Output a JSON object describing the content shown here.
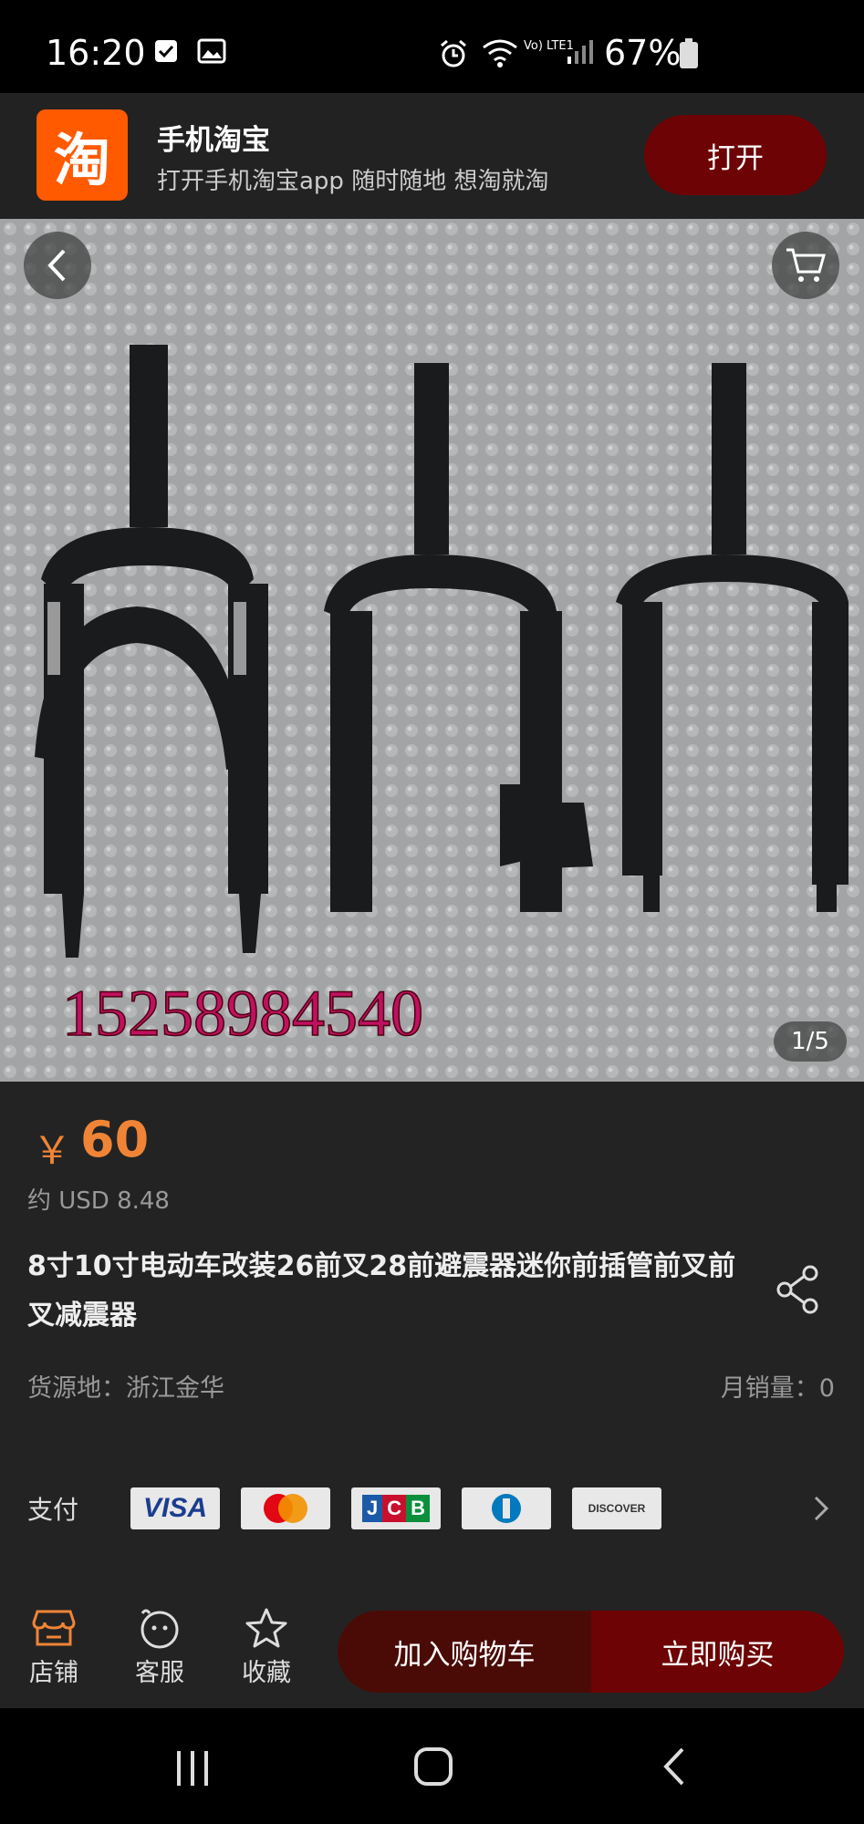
{
  "status_bar": {
    "time": "16:20",
    "battery": "67%",
    "icons": [
      "checkbox-icon",
      "gallery-icon",
      "alarm-icon",
      "wifi-icon",
      "volte-icon",
      "signal-icon",
      "battery-icon"
    ],
    "network_label": "Vo) LTE1"
  },
  "banner": {
    "app_icon_glyph": "淘",
    "app_name": "手机淘宝",
    "subtitle": "打开手机淘宝app 随时随地 想淘就淘",
    "open_label": "打开"
  },
  "gallery": {
    "counter": "1/5",
    "watermark": "15258984540"
  },
  "product": {
    "currency_symbol": "￥",
    "price": "60",
    "usd": "约 USD 8.48",
    "title": "8寸10寸电动车改装26前叉28前避震器迷你前插管前叉前叉减震器",
    "origin": "货源地：浙江金华",
    "sales": "月销量：0"
  },
  "payment": {
    "label": "支付",
    "cards": [
      "VISA",
      "mastercard",
      "JCB",
      "Diners",
      "DISCOVER"
    ]
  },
  "bottom_bar": {
    "store": "店铺",
    "service": "客服",
    "favorite": "收藏",
    "add_to_cart": "加入购物车",
    "buy_now": "立即购买"
  },
  "colors": {
    "accent_price": "#f08436",
    "button_dark_red": "#6d0304",
    "button_darker_red": "#4a0b06",
    "store_icon": "#f08436"
  }
}
